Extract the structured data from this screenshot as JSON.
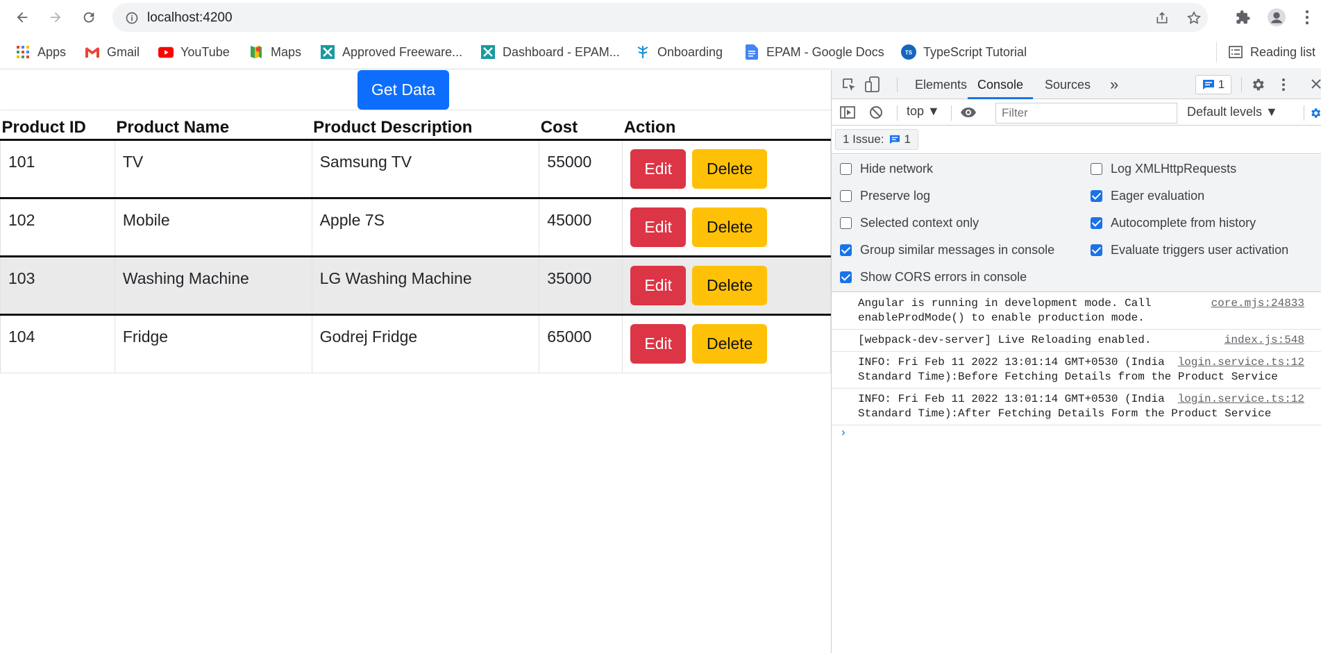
{
  "browser": {
    "url": "localhost:4200",
    "bookmarks": [
      {
        "label": "Apps",
        "icon": "apps-grid-icon"
      },
      {
        "label": "Gmail",
        "icon": "gmail-icon"
      },
      {
        "label": "YouTube",
        "icon": "youtube-icon"
      },
      {
        "label": "Maps",
        "icon": "maps-icon"
      },
      {
        "label": "Approved Freeware...",
        "icon": "tool-icon"
      },
      {
        "label": "Dashboard - EPAM...",
        "icon": "tool-icon"
      },
      {
        "label": "Onboarding",
        "icon": "onboarding-icon"
      },
      {
        "label": "EPAM - Google Docs",
        "icon": "google-docs-icon"
      },
      {
        "label": "TypeScript Tutorial",
        "icon": "typescript-icon"
      }
    ],
    "reading_list": "Reading list"
  },
  "page": {
    "get_data_label": "Get Data",
    "columns": [
      "Product ID",
      "Product Name",
      "Product Description",
      "Cost",
      "Action"
    ],
    "rows": [
      {
        "id": "101",
        "name": "TV",
        "description": "Samsung TV",
        "cost": "55000"
      },
      {
        "id": "102",
        "name": "Mobile",
        "description": "Apple 7S",
        "cost": "45000"
      },
      {
        "id": "103",
        "name": "Washing Machine",
        "description": "LG Washing Machine",
        "cost": "35000"
      },
      {
        "id": "104",
        "name": "Fridge",
        "description": "Godrej Fridge",
        "cost": "65000"
      }
    ],
    "edit_label": "Edit",
    "delete_label": "Delete"
  },
  "devtools": {
    "tabs": [
      "Elements",
      "Console",
      "Sources"
    ],
    "active_tab": "Console",
    "more_tabs": "»",
    "issue_count": "1",
    "context": "top ▼",
    "filter_placeholder": "Filter",
    "levels": "Default levels ▼",
    "issues_label": "1 Issue:",
    "issues_count": "1",
    "settings": {
      "left": [
        {
          "label": "Hide network",
          "checked": false
        },
        {
          "label": "Preserve log",
          "checked": false
        },
        {
          "label": "Selected context only",
          "checked": false
        },
        {
          "label": "Group similar messages in console",
          "checked": true
        },
        {
          "label": "Show CORS errors in console",
          "checked": true
        }
      ],
      "right": [
        {
          "label": "Log XMLHttpRequests",
          "checked": false
        },
        {
          "label": "Eager evaluation",
          "checked": true
        },
        {
          "label": "Autocomplete from history",
          "checked": true
        },
        {
          "label": "Evaluate triggers user activation",
          "checked": true
        }
      ]
    },
    "messages": [
      {
        "text": "Angular is running in development mode. Call enableProdMode() to enable production mode.",
        "source": "core.mjs:24833"
      },
      {
        "text": "[webpack-dev-server] Live Reloading enabled.",
        "source": "index.js:548"
      },
      {
        "text": "INFO: Fri Feb 11 2022 13:01:14 GMT+0530 (India Standard Time):Before Fetching Details from the Product Service",
        "source": "login.service.ts:12"
      },
      {
        "text": "INFO: Fri Feb 11 2022 13:01:14 GMT+0530 (India Standard Time):After Fetching Details Form the Product Service",
        "source": "login.service.ts:12"
      }
    ],
    "prompt": "›"
  },
  "colors": {
    "primary": "#0d6efd",
    "danger": "#dc3545",
    "warning": "#ffc107",
    "devtools_accent": "#1a73e8"
  }
}
